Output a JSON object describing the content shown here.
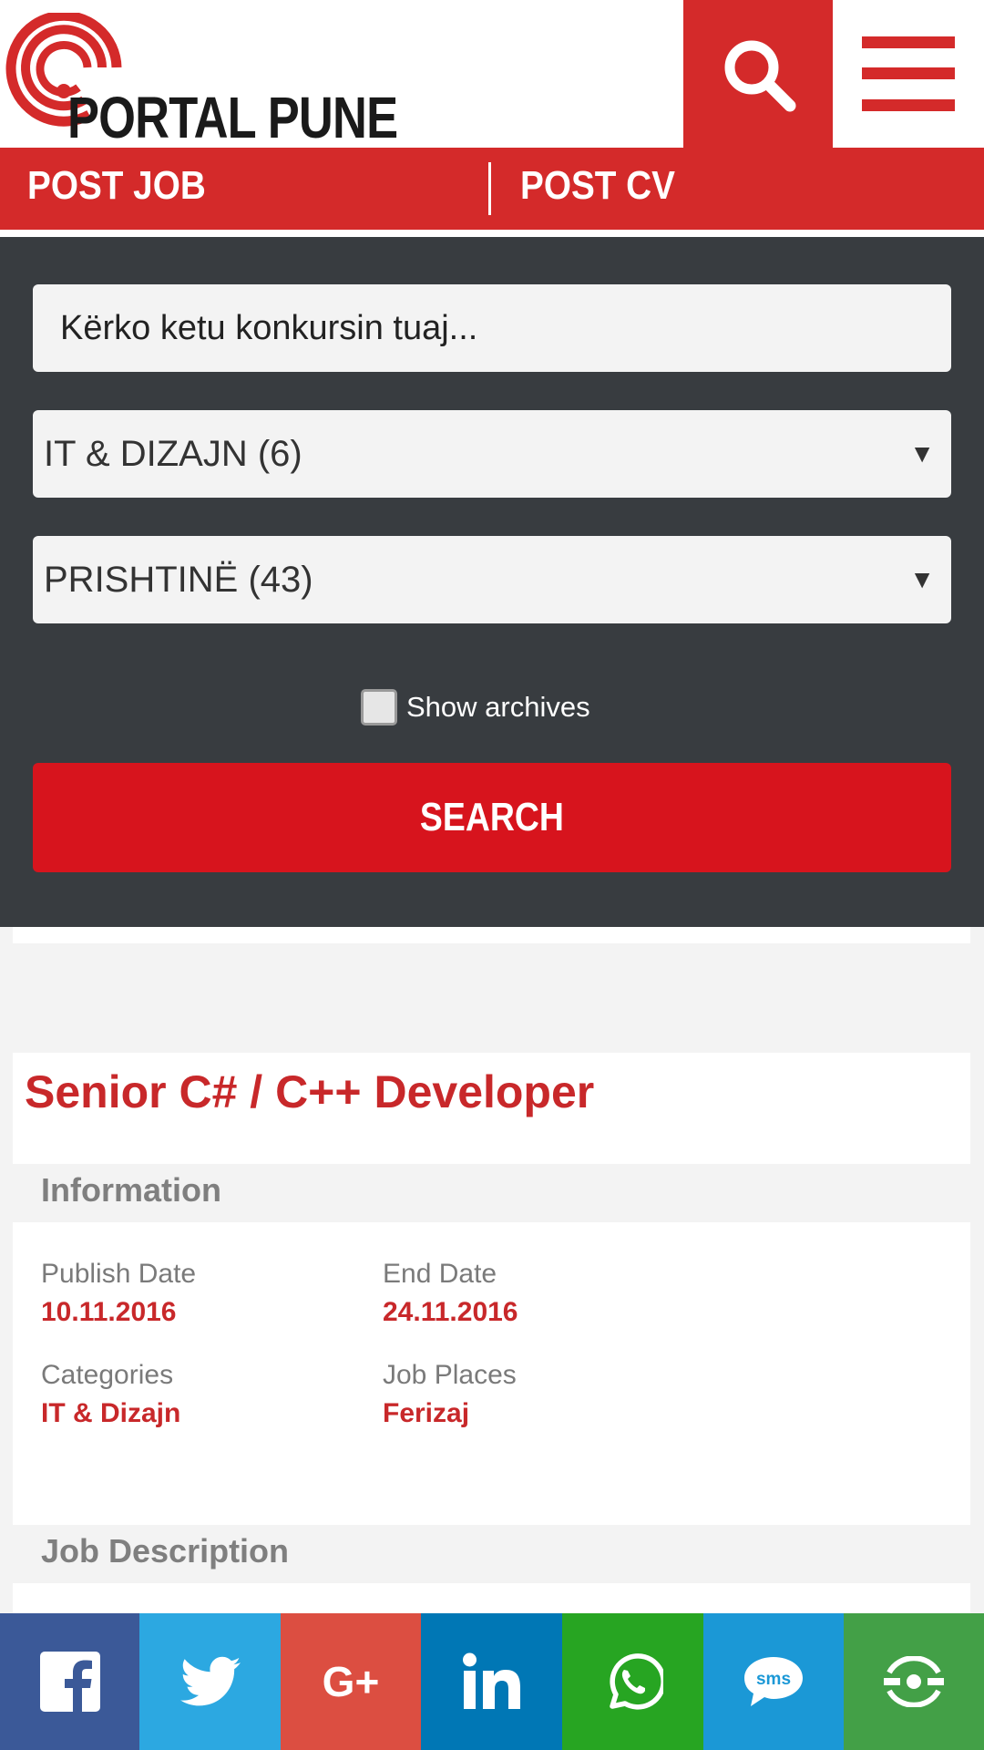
{
  "header": {
    "logo_text": "PORTAL PUNE",
    "search_icon": "search-icon",
    "menu_icon": "hamburger-menu-icon"
  },
  "postbar": {
    "post_job": "POST JOB",
    "post_cv": "POST CV"
  },
  "search_form": {
    "keyword_placeholder": "Kërko ketu konkursin tuaj...",
    "category_selected": "IT & DIZAJN (6)",
    "city_selected": "PRISHTINË (43)",
    "show_archives_label": "Show archives",
    "search_button": "SEARCH"
  },
  "job": {
    "title": "Senior C# / C++ Developer",
    "information_heading": "Information",
    "publish_date_label": "Publish Date",
    "publish_date": "10.11.2016",
    "end_date_label": "End Date",
    "end_date": "24.11.2016",
    "categories_label": "Categories",
    "categories": "IT & Dizajn",
    "job_places_label": "Job Places",
    "job_places": "Ferizaj",
    "description_heading": "Job Description"
  },
  "share_bar": {
    "buttons": [
      {
        "icon": "facebook-icon",
        "color": "#3b5998"
      },
      {
        "icon": "twitter-icon",
        "color": "#2ca8e1"
      },
      {
        "icon": "google-plus-icon",
        "color": "#dc4e41"
      },
      {
        "icon": "linkedin-icon",
        "color": "#0077b5"
      },
      {
        "icon": "whatsapp-icon",
        "color": "#27a522"
      },
      {
        "icon": "sms-icon",
        "color": "#1b98d6"
      },
      {
        "icon": "more-share-icon",
        "color": "#43a047"
      }
    ],
    "sms_icon_text": "sms",
    "google_plus_icon_text": "G+"
  },
  "colors": {
    "brand_red": "#d42a2a",
    "panel_dark": "#383c40",
    "title_red": "#c8282a"
  }
}
